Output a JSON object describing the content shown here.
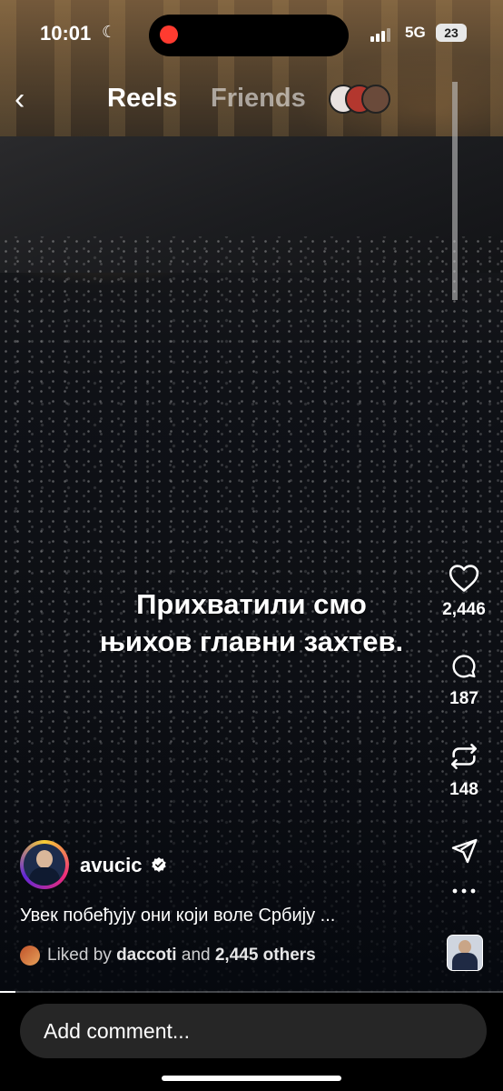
{
  "status_bar": {
    "time": "10:01",
    "network": "5G",
    "battery": "23"
  },
  "header": {
    "tabs": [
      {
        "label": "Reels",
        "active": true
      },
      {
        "label": "Friends",
        "active": false
      }
    ]
  },
  "video": {
    "overlay_caption_lines": [
      "Прихватили смо",
      "њихов главни захтев."
    ],
    "progress_fraction": 0.03
  },
  "actions": {
    "likes": "2,446",
    "comments": "187",
    "reposts": "148"
  },
  "author": {
    "username": "avucic",
    "verified": true,
    "caption": "Увек побеђују они који воле Србију ...",
    "liked_by_prefix": "Liked by",
    "liked_by_user": "daccoti",
    "liked_by_and": "and",
    "liked_by_others": "2,445 others"
  },
  "comment_bar": {
    "placeholder": "Add comment..."
  },
  "colors": {
    "record_dot": "#ff3b30",
    "comment_box": "#262626",
    "verified_badge": "#ffffff"
  },
  "icons": [
    "back-chevron-icon",
    "heart-icon",
    "comment-bubble-icon",
    "repost-icon",
    "share-send-icon",
    "more-icon",
    "verified-icon",
    "moon-icon",
    "signal-icon"
  ]
}
